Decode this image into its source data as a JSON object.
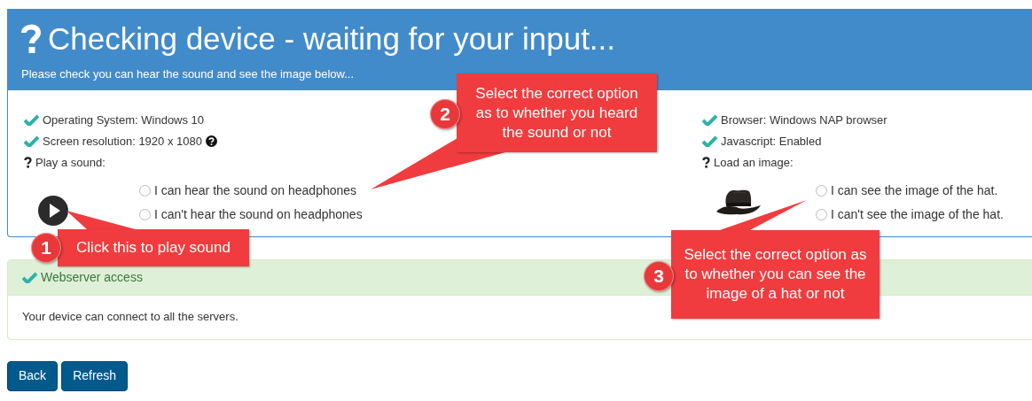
{
  "header": {
    "title": "Checking device - waiting for your input...",
    "subtitle": "Please check you can hear the sound and see the image below..."
  },
  "left_checks": [
    {
      "kind": "check",
      "label": "Operating System: Windows 10",
      "help": false
    },
    {
      "kind": "check",
      "label": "Screen resolution: 1920 x 1080",
      "help": true
    },
    {
      "kind": "question",
      "label": "Play a sound:",
      "help": false
    }
  ],
  "sound_options": [
    {
      "label": "I can hear the sound on headphones",
      "selected": false
    },
    {
      "label": "I can't hear the sound on headphones",
      "selected": false
    }
  ],
  "right_checks": [
    {
      "kind": "check",
      "label": "Browser: Windows NAP browser",
      "help": false
    },
    {
      "kind": "check",
      "label": "Javascript: Enabled",
      "help": false
    },
    {
      "kind": "question",
      "label": "Load an image:",
      "help": false
    }
  ],
  "image_options": [
    {
      "label": "I can see the image of the hat.",
      "selected": false
    },
    {
      "label": "I can't see the image of the hat.",
      "selected": false
    }
  ],
  "webserver_panel": {
    "heading": "Webserver access",
    "body": "Your device can connect to all the servers."
  },
  "buttons": [
    "Back",
    "Refresh"
  ],
  "callouts": [
    {
      "number": "1",
      "text": "Click this to play sound"
    },
    {
      "number": "2",
      "text": "Select the correct option as to whether you heard the sound or not"
    },
    {
      "number": "3",
      "text": "Select the correct option as to whether you can see the image of a hat or not"
    }
  ]
}
